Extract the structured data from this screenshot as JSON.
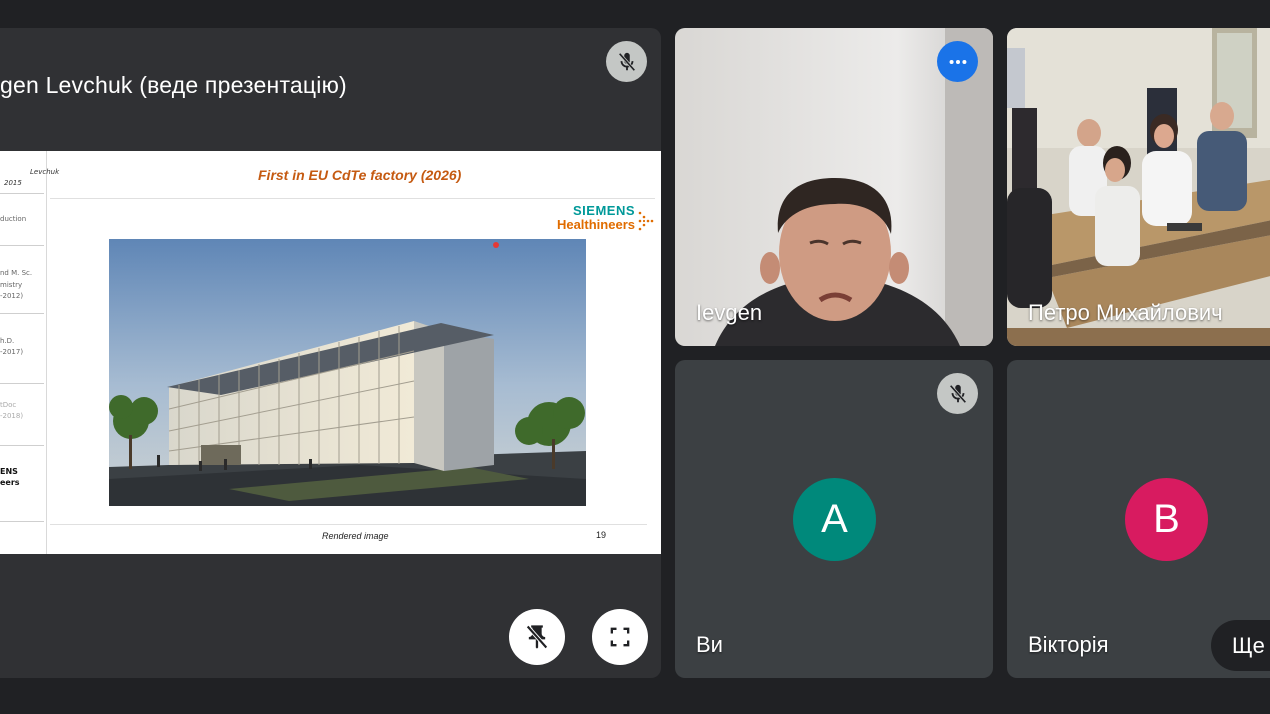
{
  "presenter": {
    "name": "gen Levchuk (веде презентацію)"
  },
  "slide": {
    "title": "First in EU CdTe factory (2026)",
    "brand_line1": "SIEMENS",
    "brand_line2": "Healthineers",
    "caption": "Rendered image",
    "page_number": "19",
    "left_panel": [
      "Levchuk",
      "2015",
      "duction",
      "nd M. Sc.",
      "mistry",
      "-2012)",
      "h.D.",
      "-2017)",
      "tDoc",
      "-2018)",
      "ENS",
      "eers"
    ]
  },
  "participants": [
    {
      "name": "Ievgen",
      "type": "video",
      "control_icon": "more-options-icon"
    },
    {
      "name": "Петро Михайлович",
      "type": "video"
    },
    {
      "name": "Ви",
      "avatar_letter": "A",
      "avatar_color": "#00897b",
      "muted": true
    },
    {
      "name": "Вікторія",
      "avatar_letter": "B",
      "avatar_color": "#d81b60"
    }
  ],
  "more_label": "Ще",
  "colors": {
    "background": "#202124",
    "tile": "#3c4043",
    "accent_blue": "#1a73e8",
    "slide_title": "#c55a11",
    "siemens_teal": "#009999",
    "siemens_orange": "#e06c00"
  }
}
